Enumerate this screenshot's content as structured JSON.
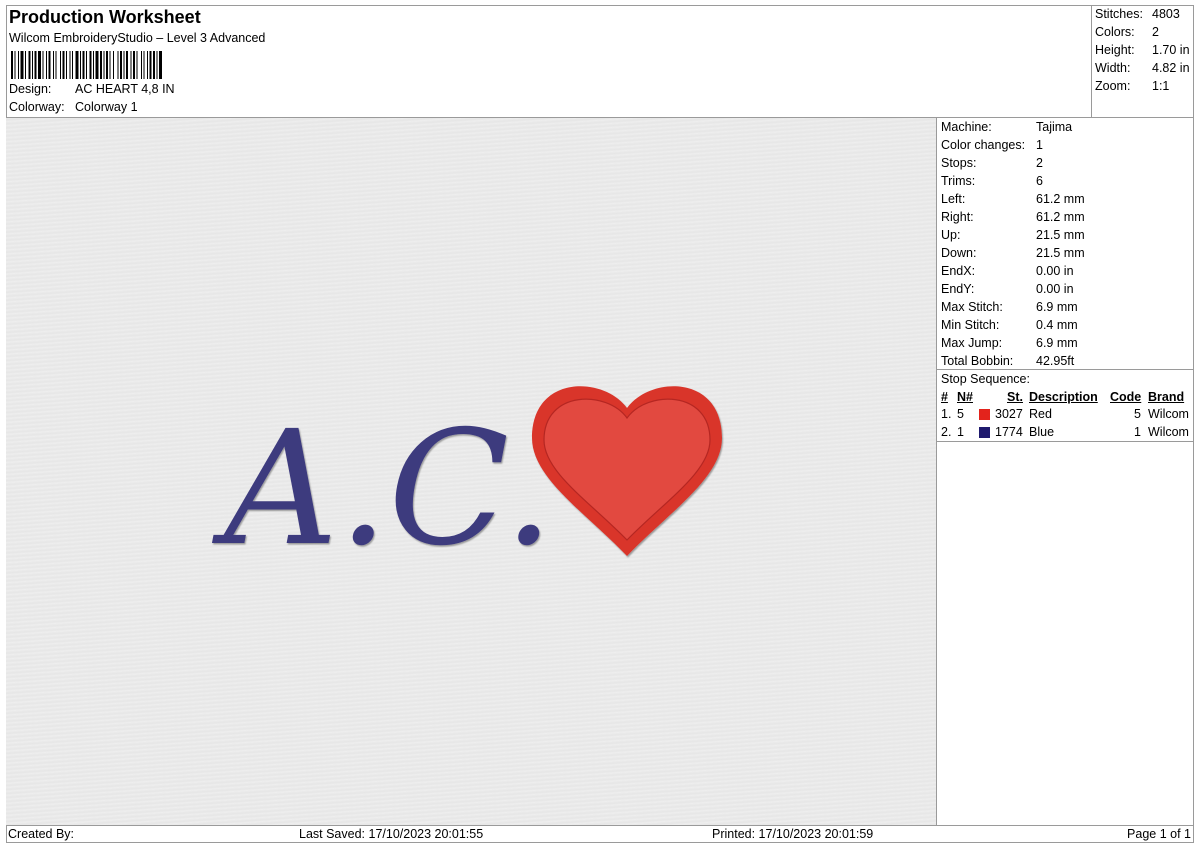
{
  "header": {
    "title": "Production Worksheet",
    "subtitle": "Wilcom EmbroideryStudio – Level 3 Advanced",
    "design_label": "Design:",
    "design_value": "AC HEART 4,8 IN",
    "colorway_label": "Colorway:",
    "colorway_value": "Colorway 1"
  },
  "stats": {
    "stitches_label": "Stitches:",
    "stitches": "4803",
    "colors_label": "Colors:",
    "colors": "2",
    "height_label": "Height:",
    "height": "1.70 in",
    "width_label": "Width:",
    "width": "4.82 in",
    "zoom_label": "Zoom:",
    "zoom": "1:1"
  },
  "artwork": {
    "lettering": "A.C.",
    "thread_colors": {
      "blue": "#3d3a7e",
      "red": "#d9352c"
    }
  },
  "machine_info": [
    {
      "label": "Machine:",
      "value": "Tajima"
    },
    {
      "label": "Color changes:",
      "value": "1"
    },
    {
      "label": "Stops:",
      "value": "2"
    },
    {
      "label": "Trims:",
      "value": "6"
    },
    {
      "label": "Left:",
      "value": "61.2 mm"
    },
    {
      "label": "Right:",
      "value": "61.2 mm"
    },
    {
      "label": "Up:",
      "value": "21.5 mm"
    },
    {
      "label": "Down:",
      "value": "21.5 mm"
    },
    {
      "label": "EndX:",
      "value": "0.00 in"
    },
    {
      "label": "EndY:",
      "value": "0.00 in"
    },
    {
      "label": "Max Stitch:",
      "value": "6.9 mm"
    },
    {
      "label": "Min Stitch:",
      "value": "0.4 mm"
    },
    {
      "label": "Max Jump:",
      "value": "6.9 mm"
    },
    {
      "label": "Total Bobbin:",
      "value": "42.95ft"
    }
  ],
  "stop_sequence": {
    "label": "Stop Sequence:",
    "headers": {
      "num": "#",
      "n": "N#",
      "st": "St.",
      "description": "Description",
      "code": "Code",
      "brand": "Brand"
    },
    "rows": [
      {
        "num": "1.",
        "n": "5",
        "color": "#e3231c",
        "st": "3027",
        "description": "Red",
        "code": "5",
        "brand": "Wilcom"
      },
      {
        "num": "2.",
        "n": "1",
        "color": "#1f1a6e",
        "st": "1774",
        "description": "Blue",
        "code": "1",
        "brand": "Wilcom"
      }
    ]
  },
  "footer": {
    "created_by": "Created By:",
    "last_saved": "Last Saved: 17/10/2023 20:01:55",
    "printed": "Printed: 17/10/2023 20:01:59",
    "page": "Page 1 of 1"
  }
}
